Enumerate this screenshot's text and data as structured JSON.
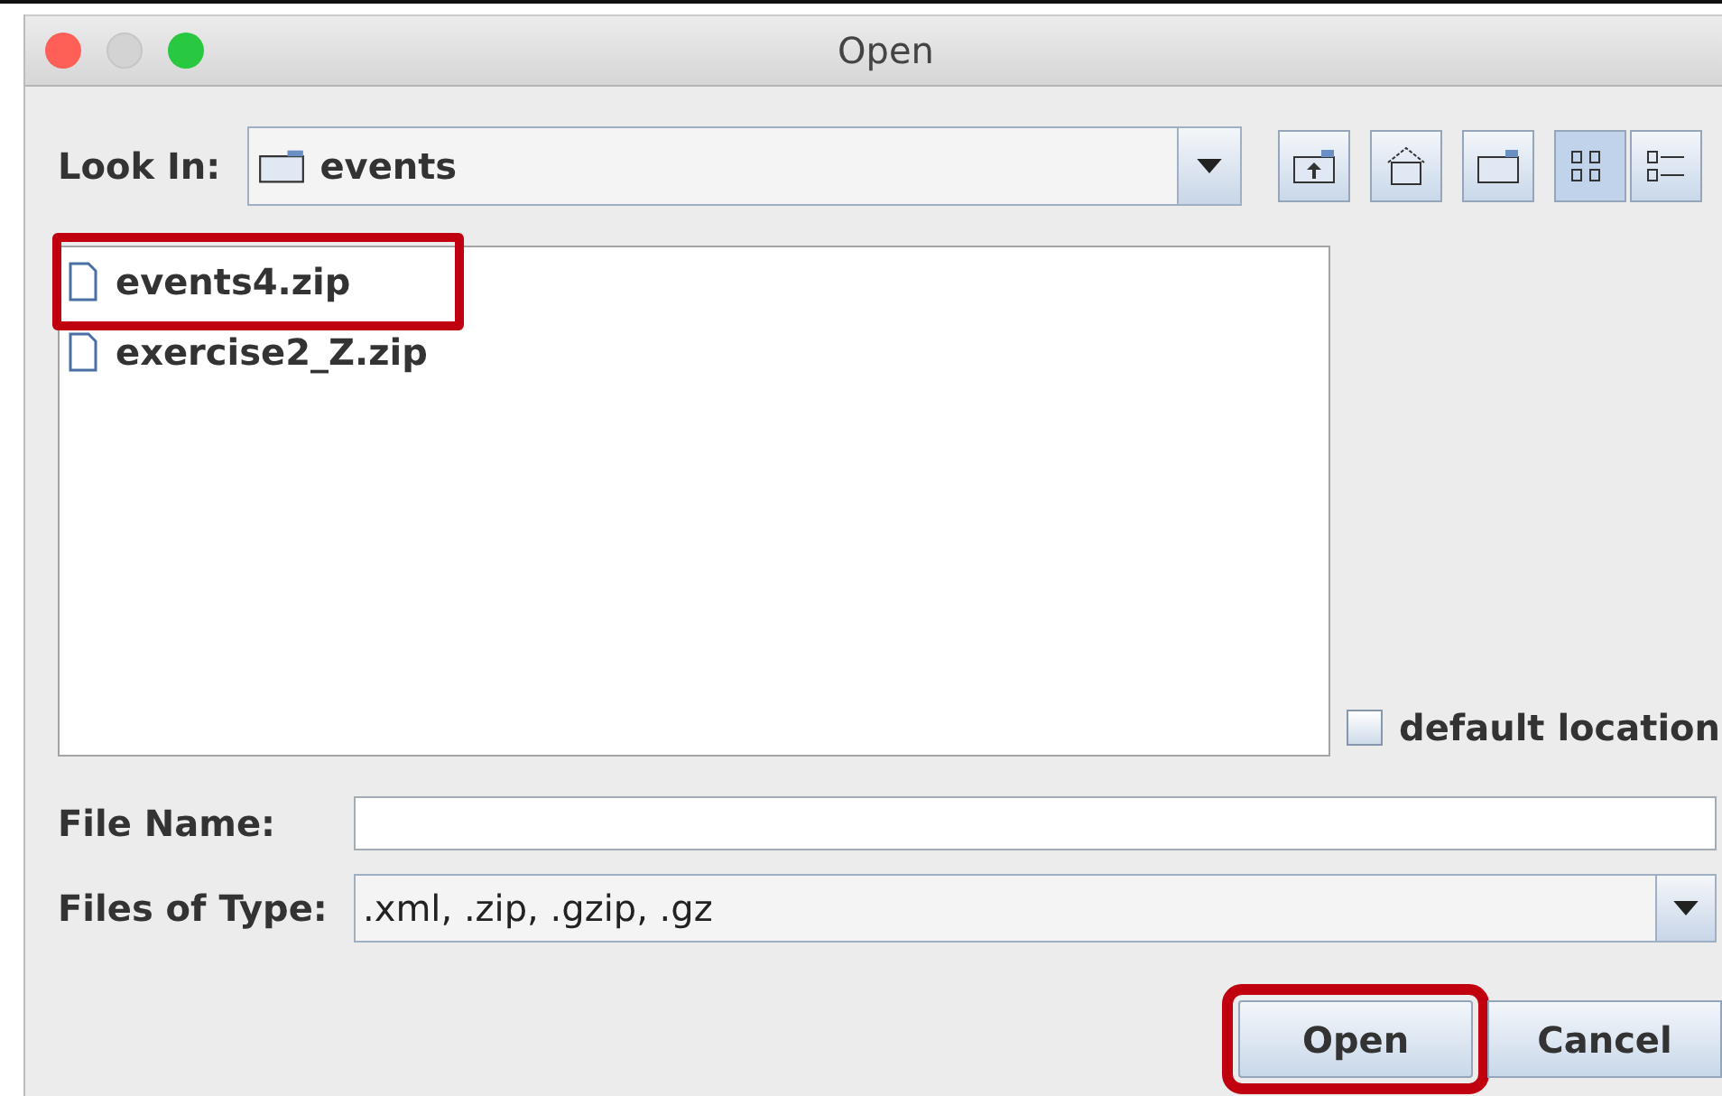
{
  "window": {
    "title": "Open"
  },
  "look_in": {
    "label": "Look In:",
    "value": "events"
  },
  "toolbar": [
    {
      "kind": "up"
    },
    {
      "kind": "home"
    },
    {
      "kind": "new-folder"
    },
    {
      "kind": "list",
      "selected": true
    },
    {
      "kind": "details",
      "selected": false
    }
  ],
  "files": [
    {
      "name": "events4.zip",
      "highlighted": true
    },
    {
      "name": "exercise2_Z.zip",
      "highlighted": false
    }
  ],
  "default_location": {
    "label": "default location",
    "checked": false
  },
  "file_name": {
    "label": "File Name:"
  },
  "files_of_type": {
    "label": "Files of Type:",
    "value": ".xml, .zip, .gzip, .gz"
  },
  "buttons": [
    {
      "label": "Open",
      "highlighted": true
    },
    {
      "label": "Cancel",
      "highlighted": false
    }
  ]
}
